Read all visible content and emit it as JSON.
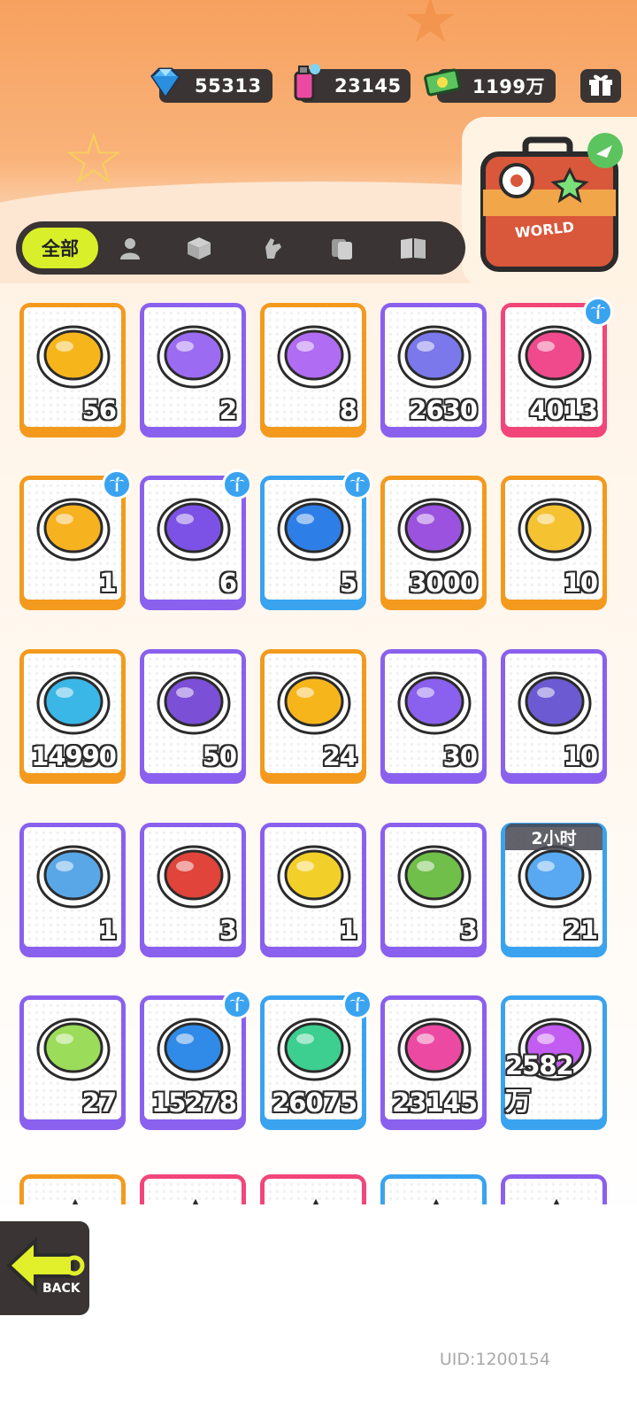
{
  "currencies": [
    {
      "icon": "diamond-icon",
      "value": "55313"
    },
    {
      "icon": "paint-spray-can-icon",
      "value": "23145"
    },
    {
      "icon": "cash-bill-icon",
      "value": "1199万"
    }
  ],
  "gift_icon": "gift-icon",
  "travel_case": {
    "icon": "travel-suitcase-icon",
    "label": "WORLD"
  },
  "tabs": [
    {
      "label": "全部",
      "icon": "",
      "active": true
    },
    {
      "label": "",
      "icon": "person-icon"
    },
    {
      "label": "",
      "icon": "box-icon"
    },
    {
      "label": "",
      "icon": "hand-gesture-icon"
    },
    {
      "label": "",
      "icon": "cards-icon"
    },
    {
      "label": "",
      "icon": "book-icon"
    }
  ],
  "items": [
    {
      "name": "gold-ticket",
      "count": "56",
      "frame": "orange",
      "badge": false,
      "color": "#f6b51b"
    },
    {
      "name": "purple-ticket",
      "count": "2",
      "frame": "purple",
      "badge": false,
      "color": "#9b6cf2"
    },
    {
      "name": "rainbow-shard",
      "count": "8",
      "frame": "orange",
      "badge": false,
      "color": "#b06cf2"
    },
    {
      "name": "blue-crystal-star",
      "count": "2630",
      "frame": "purple",
      "badge": false,
      "color": "#7a78ea"
    },
    {
      "name": "pink-crayon",
      "count": "4013",
      "frame": "pink",
      "badge": true,
      "color": "#f04a8d"
    },
    {
      "name": "yellow-crayon",
      "count": "1",
      "frame": "orange",
      "badge": true,
      "color": "#f7b21f"
    },
    {
      "name": "purple-crayon",
      "count": "6",
      "frame": "purple",
      "badge": true,
      "color": "#7c52e6"
    },
    {
      "name": "blue-crayon",
      "count": "5",
      "frame": "blue",
      "badge": true,
      "color": "#2e7ee8"
    },
    {
      "name": "cool-sticker-badge",
      "count": "3000",
      "frame": "orange",
      "badge": false,
      "color": "#9b52de"
    },
    {
      "name": "star-burst-badge",
      "count": "10",
      "frame": "orange",
      "badge": false,
      "color": "#f5c232"
    },
    {
      "name": "season-pass-ticket",
      "count": "14990",
      "frame": "orange",
      "badge": false,
      "color": "#3ab7e6"
    },
    {
      "name": "mystery-egg",
      "count": "50",
      "frame": "purple",
      "badge": false,
      "color": "#7b4fd6"
    },
    {
      "name": "gold-deity-puzzle",
      "count": "24",
      "frame": "orange",
      "badge": false,
      "color": "#f6b51b"
    },
    {
      "name": "purple-deity-puzzle",
      "count": "30",
      "frame": "purple",
      "badge": false,
      "color": "#8a60ee"
    },
    {
      "name": "travel-card-puzzle",
      "count": "10",
      "frame": "purple",
      "badge": false,
      "color": "#6c5ad2"
    },
    {
      "name": "fish-mpets-ball",
      "count": "1",
      "frame": "purple",
      "badge": false,
      "color": "#5aa7e8"
    },
    {
      "name": "crab-mpets-ball",
      "count": "3",
      "frame": "purple",
      "badge": false,
      "color": "#e0443a"
    },
    {
      "name": "chick-mpets-ball",
      "count": "1",
      "frame": "purple",
      "badge": false,
      "color": "#f3cf29"
    },
    {
      "name": "sprout-mpets-ball",
      "count": "3",
      "frame": "purple",
      "badge": false,
      "color": "#6fbf4a"
    },
    {
      "name": "alarm-clock",
      "count": "21",
      "frame": "blue",
      "badge": false,
      "color": "#58a9f2",
      "timer": "2小时"
    },
    {
      "name": "open-cup",
      "count": "27",
      "frame": "purple",
      "badge": false,
      "color": "#9bdc5a"
    },
    {
      "name": "blue-spray-can",
      "count": "15278",
      "frame": "purple",
      "badge": true,
      "color": "#2f8ae8"
    },
    {
      "name": "paint-tube-green",
      "count": "26075",
      "frame": "blue",
      "badge": true,
      "color": "#3ccf90"
    },
    {
      "name": "pink-spray-can",
      "count": "23145",
      "frame": "purple",
      "badge": false,
      "color": "#ec4aa2"
    },
    {
      "name": "rainbow-paint-tube",
      "count": "2582万",
      "frame": "blue",
      "badge": false,
      "color": "#c35cf0"
    }
  ],
  "partial_row": [
    {
      "frame": "orange",
      "color": "#f6d36b"
    },
    {
      "frame": "pink",
      "color": "#f5b28a"
    },
    {
      "frame": "pink",
      "color": "#f07a5a"
    },
    {
      "frame": "blue",
      "color": "#48b6f0"
    },
    {
      "frame": "purple",
      "color": "#9b6cf2"
    }
  ],
  "back_button": {
    "label": "BACK"
  },
  "uid": "UID:1200154"
}
